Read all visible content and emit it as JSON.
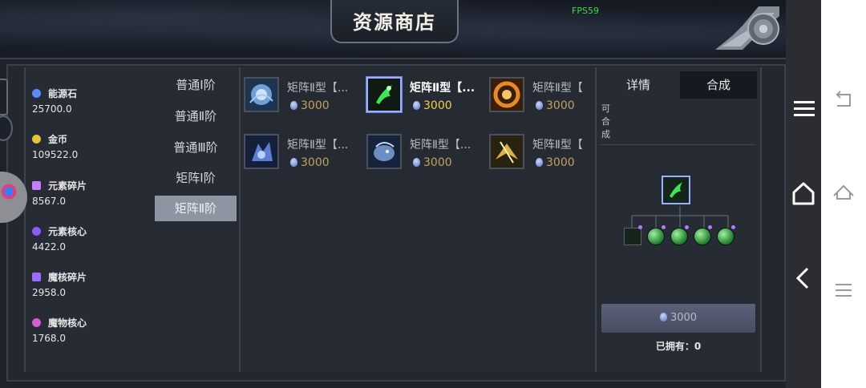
{
  "header": {
    "title": "资源商店",
    "fps": "FPS59"
  },
  "resources": [
    {
      "name": "能源石",
      "value": "25700.0",
      "icon": "energy-stone-icon",
      "color": "#5b8cff"
    },
    {
      "name": "金币",
      "value": "109522.0",
      "icon": "gold-coin-icon",
      "color": "#e5c23a"
    },
    {
      "name": "元素碎片",
      "value": "8567.0",
      "icon": "element-shard-icon",
      "color": "#c57cff"
    },
    {
      "name": "元素核心",
      "value": "4422.0",
      "icon": "element-core-icon",
      "color": "#8a5cff"
    },
    {
      "name": "魔核碎片",
      "value": "2958.0",
      "icon": "magic-core-shard-icon",
      "color": "#9a6cff"
    },
    {
      "name": "魔物核心",
      "value": "1768.0",
      "icon": "monster-core-icon",
      "color": "#d65cd0"
    }
  ],
  "tabs": [
    {
      "label": "普通Ⅰ阶",
      "active": false
    },
    {
      "label": "普通Ⅱ阶",
      "active": false
    },
    {
      "label": "普通Ⅲ阶",
      "active": false
    },
    {
      "label": "矩阵Ⅰ阶",
      "active": false
    },
    {
      "label": "矩阵Ⅱ阶",
      "active": true
    }
  ],
  "items": [
    {
      "name": "矩阵Ⅱ型【...",
      "price": "3000",
      "selected": false,
      "icon": "blue-orb-item-icon"
    },
    {
      "name": "矩阵Ⅱ型【...",
      "price": "3000",
      "selected": true,
      "icon": "green-claw-item-icon"
    },
    {
      "name": "矩阵Ⅱ型【",
      "price": "3000",
      "selected": false,
      "icon": "orange-swirl-item-icon"
    },
    {
      "name": "矩阵Ⅱ型【...",
      "price": "3000",
      "selected": false,
      "icon": "blue-beast-item-icon"
    },
    {
      "name": "矩阵Ⅱ型【...",
      "price": "3000",
      "selected": false,
      "icon": "blue-dragon-item-icon"
    },
    {
      "name": "矩阵Ⅱ型【",
      "price": "3000",
      "selected": false,
      "icon": "gold-wing-item-icon"
    }
  ],
  "detail": {
    "tab_detail": "详情",
    "tab_compose": "合成",
    "can_compose": "可合成",
    "buy_price": "3000",
    "owned": "已拥有：0"
  },
  "colors": {
    "accent_select": "#9ab0ff",
    "price_gold": "#c0a35c",
    "fps_green": "#3ddc4b"
  }
}
